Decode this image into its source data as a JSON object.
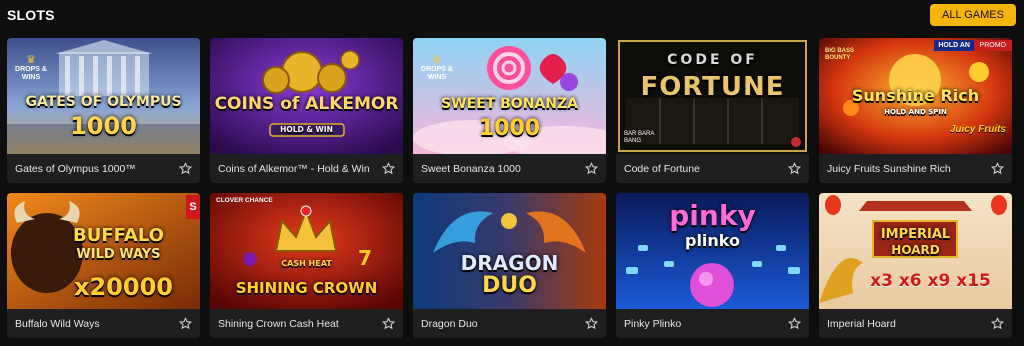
{
  "header": {
    "title": "SLOTS",
    "all_games_label": "ALL GAMES"
  },
  "colors": {
    "accent": "#f5b50a",
    "background": "#0e0e0f",
    "card": "#1f1f21",
    "promo": "#c91c1c"
  },
  "games": [
    {
      "name": "Gates of Olympus 1000™",
      "art": {
        "line1": "GATES OF OLYMPUS",
        "line2": "1000",
        "badge": "DROPS & WINS"
      }
    },
    {
      "name": "Coins of Alkemor™ - Hold & Win",
      "art": {
        "line1": "COINS of ALKEMOR",
        "line2": "HOLD & WIN"
      }
    },
    {
      "name": "Sweet Bonanza 1000",
      "art": {
        "line1": "SWEET BONANZA",
        "line2": "1000",
        "badge": "DROPS & WINS"
      }
    },
    {
      "name": "Code of Fortune",
      "art": {
        "line1": "CODE OF",
        "line2": "FORTUNE",
        "corner": "BAR BARA BANG"
      }
    },
    {
      "name": "Juicy Fruits Sunshine Rich",
      "art": {
        "line1": "Sunshine Rich",
        "line2": "HOLD AND SPIN",
        "promo": "PROMO",
        "hold": "HOLD AN",
        "brand": "BIG BASS BOUNTY",
        "sub": "Juicy Fruits"
      }
    },
    {
      "name": "Buffalo Wild Ways",
      "art": {
        "line1": "BUFFALO",
        "line2": "WILD WAYS",
        "line3": "x20000",
        "side": "S"
      }
    },
    {
      "name": "Shining Crown Cash Heat",
      "art": {
        "line1": "CASH HEAT",
        "line2": "SHINING CROWN",
        "badge": "CLOVER CHANCE"
      }
    },
    {
      "name": "Dragon Duo",
      "art": {
        "line1": "DRAGON",
        "line2": "DUO"
      }
    },
    {
      "name": "Pinky Plinko",
      "art": {
        "line1": "pinky",
        "line2": "plinko"
      }
    },
    {
      "name": "Imperial Hoard",
      "art": {
        "line1": "IMPERIAL",
        "line2": "HOARD",
        "line3": "x3 x6 x9 x15"
      }
    }
  ]
}
